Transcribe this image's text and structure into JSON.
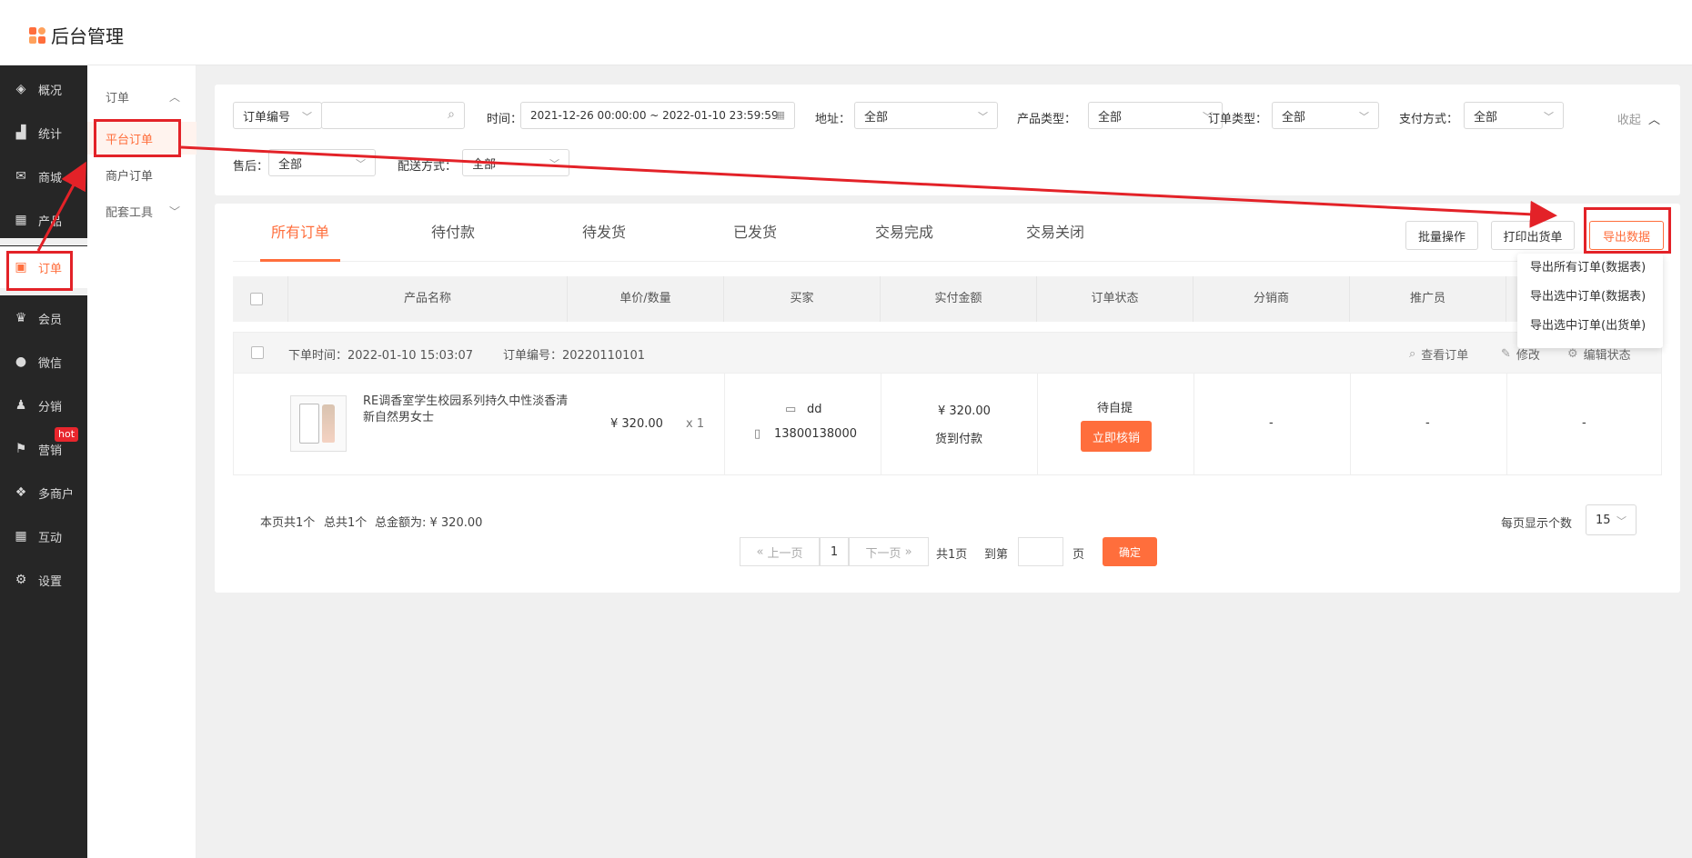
{
  "app": {
    "title": "后台管理"
  },
  "sidebar": {
    "items": [
      {
        "label": "概况",
        "icon": "layers-icon"
      },
      {
        "label": "统计",
        "icon": "chart-icon"
      },
      {
        "label": "商城",
        "icon": "mail-icon"
      },
      {
        "label": "产品",
        "icon": "grid-icon"
      },
      {
        "label": "订单",
        "icon": "order-icon"
      },
      {
        "label": "会员",
        "icon": "crown-icon"
      },
      {
        "label": "微信",
        "icon": "wechat-icon"
      },
      {
        "label": "分销",
        "icon": "users-icon"
      },
      {
        "label": "营销",
        "icon": "flag-icon"
      },
      {
        "label": "多商户",
        "icon": "store-icon"
      },
      {
        "label": "互动",
        "icon": "apps-icon"
      },
      {
        "label": "设置",
        "icon": "gear-icon"
      }
    ],
    "hot_badge": "hot"
  },
  "subnav": {
    "group1": "订单",
    "item_platform": "平台订单",
    "item_merchant": "商户订单",
    "group2": "配套工具"
  },
  "filters": {
    "order_no_select": "订单编号",
    "time_label": "时间：",
    "time_value": "2021-12-26 00:00:00 ~ 2022-01-10 23:59:59",
    "address_label": "地址：",
    "address_value": "全部",
    "product_type_label": "产品类型：",
    "product_type_value": "全部",
    "order_type_label": "订单类型：",
    "order_type_value": "全部",
    "pay_label": "支付方式：",
    "pay_value": "全部",
    "collapse": "收起",
    "after_sale_label": "售后：",
    "after_sale_value": "全部",
    "delivery_label": "配送方式：",
    "delivery_value": "全部"
  },
  "tabs": [
    "所有订单",
    "待付款",
    "待发货",
    "已发货",
    "交易完成",
    "交易关闭"
  ],
  "actions": {
    "batch": "批量操作",
    "print": "打印出货单",
    "export": "导出数据"
  },
  "export_menu": [
    "导出所有订单(数据表)",
    "导出选中订单(数据表)",
    "导出选中订单(出货单)"
  ],
  "table": {
    "headers": [
      "产品名称",
      "单价/数量",
      "买家",
      "实付金额",
      "订单状态",
      "分销商",
      "推广员"
    ]
  },
  "order": {
    "time": "下单时间：2022-01-10 15:03:07",
    "number": "订单编号：20220110101",
    "view": "查看订单",
    "edit": "修改",
    "edit_status": "编辑状态",
    "product_name": "RE调香室学生校园系列持久中性淡香清新自然男女士",
    "price": "¥ 320.00",
    "qty": "x 1",
    "buyer_name": "dd",
    "buyer_phone": "13800138000",
    "paid": "¥ 320.00",
    "pay_method": "货到付款",
    "status": "待自提",
    "verify_btn": "立即核销",
    "distributor": "-",
    "promoter": "-",
    "extra": "-"
  },
  "footer": {
    "summary_page": "本页共1个",
    "summary_total": "总共1个",
    "summary_amount": "总金额为: ¥ 320.00",
    "prev": "上一页",
    "page": "1",
    "next": "下一页",
    "total_pages": "共1页",
    "goto": "到第",
    "page_unit": "页",
    "confirm": "确定",
    "per_page_label": "每页显示个数",
    "per_page_value": "15"
  },
  "colors": {
    "accent": "#ff6e3c",
    "annotation": "#e32228",
    "sidebar_bg": "#262626"
  }
}
